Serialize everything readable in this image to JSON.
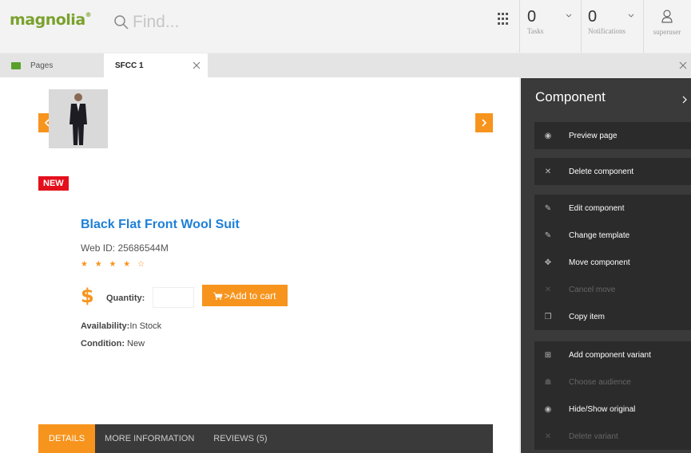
{
  "header": {
    "logo": "magnolia",
    "logo_mark": "®",
    "search_placeholder": "Find...",
    "tasks": {
      "count": "0",
      "label": "Tasks"
    },
    "notifications": {
      "count": "0",
      "label": "Notifications"
    },
    "user": "superuser"
  },
  "tabs": {
    "pages": "Pages",
    "current": "SFCC 1"
  },
  "product": {
    "badge": "NEW",
    "title": "Black Flat Front Wool Suit",
    "web_id": "Web ID: 25686544M",
    "stars": "★ ★ ★ ★ ☆",
    "currency": "$",
    "quantity_label": "Quantity:",
    "add_to_cart": ">Add to cart",
    "availability_label": "Availability:",
    "availability_value": "In Stock",
    "condition_label": "Condition:",
    "condition_value": "New",
    "tabs": [
      "DETAILS",
      "MORE INFORMATION",
      "REVIEWS (5)"
    ]
  },
  "panel": {
    "title": "Component",
    "groups": [
      [
        {
          "label": "Preview page",
          "icon": "eye-icon",
          "enabled": true
        }
      ],
      [
        {
          "label": "Delete component",
          "icon": "close-icon",
          "enabled": true
        }
      ],
      [
        {
          "label": "Edit component",
          "icon": "pencil-icon",
          "enabled": true
        },
        {
          "label": "Change template",
          "icon": "pencil-icon",
          "enabled": true
        },
        {
          "label": "Move component",
          "icon": "move-icon",
          "enabled": true
        },
        {
          "label": "Cancel move",
          "icon": "close-icon",
          "enabled": false
        },
        {
          "label": "Copy item",
          "icon": "copy-icon",
          "enabled": true
        }
      ],
      [
        {
          "label": "Add component variant",
          "icon": "add-variant-icon",
          "enabled": true
        },
        {
          "label": "Choose audience",
          "icon": "audience-icon",
          "enabled": false
        },
        {
          "label": "Hide/Show original",
          "icon": "eye-icon",
          "enabled": true
        },
        {
          "label": "Delete variant",
          "icon": "close-icon",
          "enabled": false
        }
      ]
    ]
  },
  "colors": {
    "brand_green": "#7aa12d",
    "accent_orange": "#f7941d",
    "link_blue": "#1e80d7",
    "badge_red": "#e3101c",
    "panel_bg": "#3a3a3a"
  }
}
